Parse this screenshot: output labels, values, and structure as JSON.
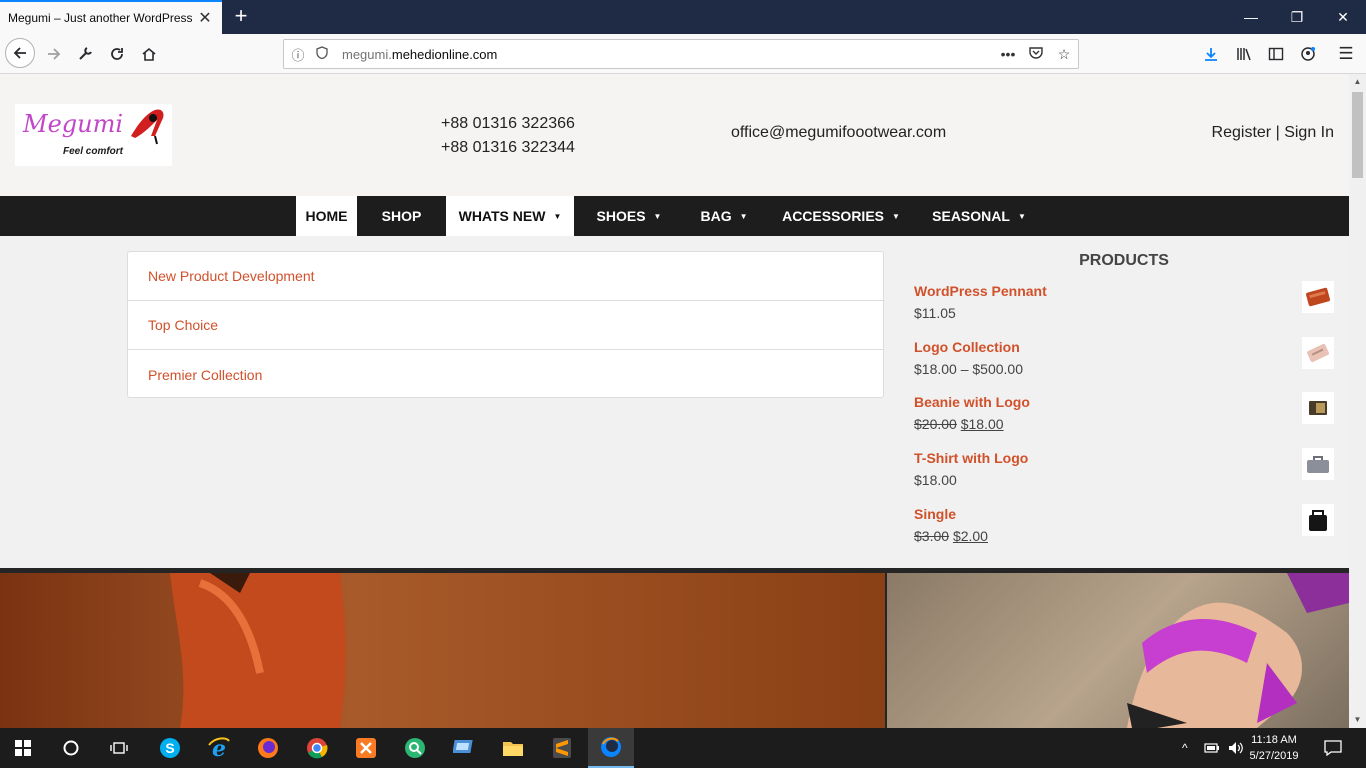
{
  "browser": {
    "tab_title": "Megumi – Just another WordPress s",
    "url_prefix": "megumi.",
    "url_domain": "mehedionline.com"
  },
  "header": {
    "logo_text": "Megumi",
    "logo_tagline": "Feel comfort",
    "phone1": "+88 01316 322366",
    "phone2": "+88 01316 322344",
    "email": "office@megumifoootwear.com",
    "register": "Register",
    "separator": "|",
    "sign_in": "Sign In"
  },
  "menu": {
    "items": [
      {
        "label": "HOME",
        "has_caret": false
      },
      {
        "label": "SHOP",
        "has_caret": false
      },
      {
        "label": "WHATS NEW",
        "has_caret": true
      },
      {
        "label": "SHOES",
        "has_caret": true
      },
      {
        "label": "BAG",
        "has_caret": true
      },
      {
        "label": "ACCESSORIES",
        "has_caret": true
      },
      {
        "label": "SEASONAL",
        "has_caret": true
      }
    ]
  },
  "submenu": {
    "items": [
      "New Product Development",
      "Top Choice",
      "Premier Collection"
    ]
  },
  "products": {
    "title": "PRODUCTS",
    "items": [
      {
        "name": "WordPress Pennant",
        "price": "$11.05",
        "old_price": "",
        "icon": "wallet-icon"
      },
      {
        "name": "Logo Collection",
        "price": "$18.00 – $500.00",
        "old_price": "",
        "icon": "clutch-icon"
      },
      {
        "name": "Beanie with Logo",
        "price": "$18.00",
        "old_price": "$20.00",
        "icon": "wallet-icon"
      },
      {
        "name": "T-Shirt with Logo",
        "price": "$18.00",
        "old_price": "",
        "icon": "briefcase-icon"
      },
      {
        "name": "Single",
        "price": "$2.00",
        "old_price": "$3.00",
        "icon": "bag-icon"
      }
    ]
  },
  "taskbar": {
    "time": "11:18 AM",
    "date": "5/27/2019"
  },
  "colors": {
    "accent": "#d1512b",
    "menu_bg": "#1d1d1d",
    "titlebar": "#1f2a44"
  }
}
